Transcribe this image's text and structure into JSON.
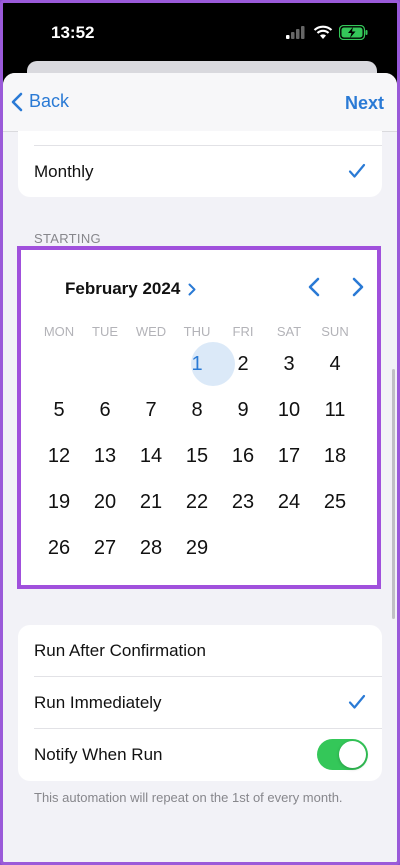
{
  "status": {
    "time": "13:52"
  },
  "nav": {
    "back_label": "Back",
    "next_label": "Next"
  },
  "repeat": {
    "selected_label": "Monthly"
  },
  "starting": {
    "header": "STARTING"
  },
  "calendar": {
    "month_title": "February 2024",
    "weekdays": [
      "MON",
      "TUE",
      "WED",
      "THU",
      "FRI",
      "SAT",
      "SUN"
    ],
    "weeks": [
      [
        "",
        "",
        "",
        "1",
        "2",
        "3",
        "4"
      ],
      [
        "5",
        "6",
        "7",
        "8",
        "9",
        "10",
        "11"
      ],
      [
        "12",
        "13",
        "14",
        "15",
        "16",
        "17",
        "18"
      ],
      [
        "19",
        "20",
        "21",
        "22",
        "23",
        "24",
        "25"
      ],
      [
        "26",
        "27",
        "28",
        "29",
        "",
        "",
        ""
      ]
    ],
    "selected_day": "1"
  },
  "options": [
    {
      "label": "Run After Confirmation",
      "checked": false
    },
    {
      "label": "Run Immediately",
      "checked": true
    },
    {
      "label": "Notify When Run",
      "toggle": true
    }
  ],
  "footer_note": "This automation will repeat on the 1st of every month.",
  "colors": {
    "accent": "#2a7ad5",
    "toggle_on": "#34c759",
    "highlight_border": "#a050dc"
  }
}
